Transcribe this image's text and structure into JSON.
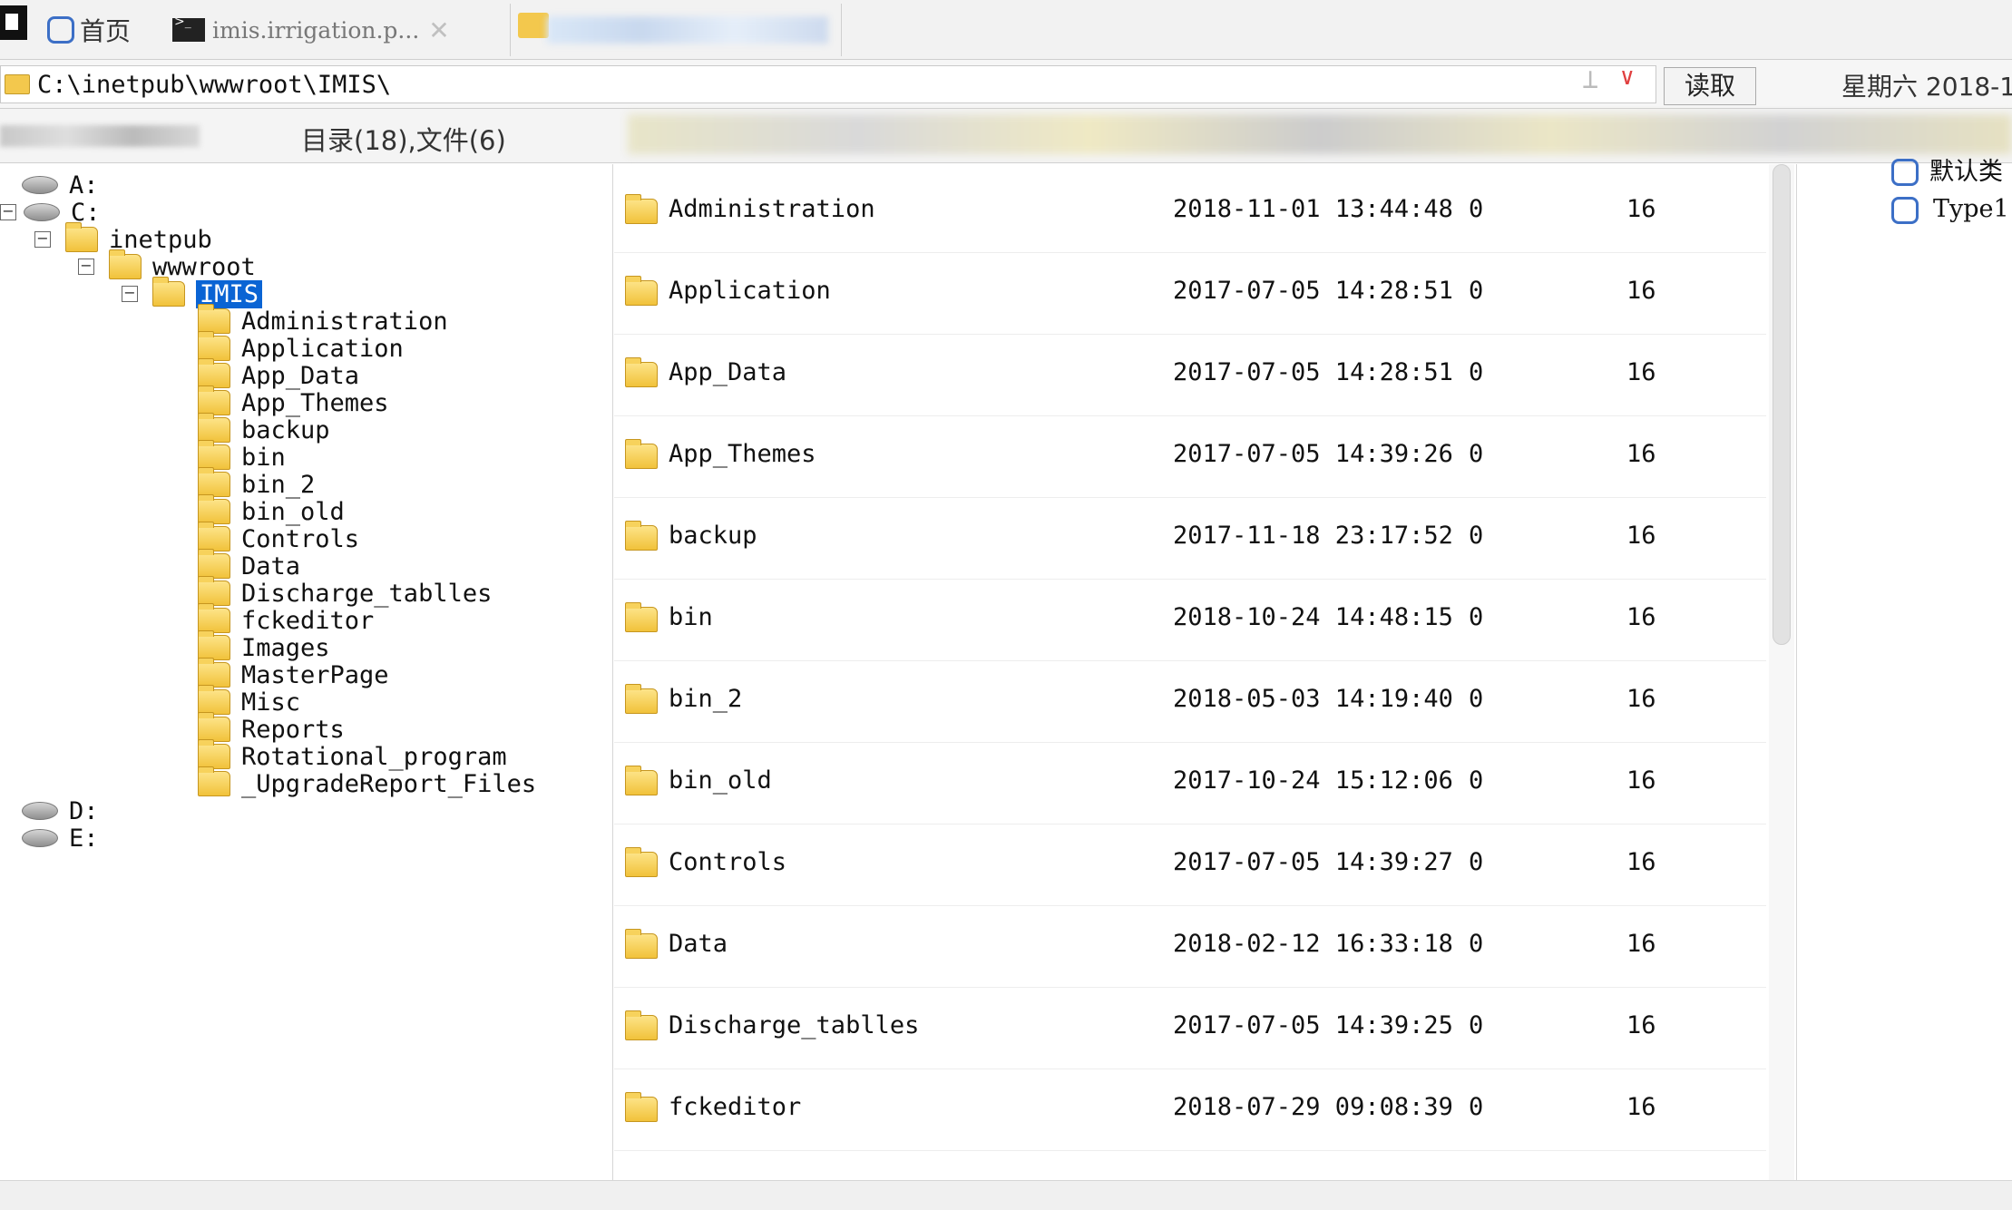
{
  "tabs": {
    "home_label": "首页",
    "file_tab_label": "imis.irrigation.p...",
    "close_glyph": "✕"
  },
  "address": {
    "path": "C:\\inetpub\\wwwroot\\IMIS\\",
    "read_button": "读取",
    "date_text": "星期六 2018-1"
  },
  "info": {
    "counts": "目录(18),文件(6)"
  },
  "tree": {
    "drives_top": [
      "A:",
      "C:"
    ],
    "inetpub": "inetpub",
    "wwwroot": "wwwroot",
    "selected": "IMIS",
    "children": [
      "Administration",
      "Application",
      "App_Data",
      "App_Themes",
      "backup",
      "bin",
      "bin_2",
      "bin_old",
      "Controls",
      "Data",
      "Discharge_tablles",
      "fckeditor",
      "Images",
      "MasterPage",
      "Misc",
      "Reports",
      "Rotational_program",
      "_UpgradeReport_Files"
    ],
    "drives_bottom": [
      "D:",
      "E:"
    ]
  },
  "files": [
    {
      "name": "Administration",
      "date": "2018-11-01 13:44:48",
      "size": "0",
      "perm": "16"
    },
    {
      "name": "Application",
      "date": "2017-07-05 14:28:51",
      "size": "0",
      "perm": "16"
    },
    {
      "name": "App_Data",
      "date": "2017-07-05 14:28:51",
      "size": "0",
      "perm": "16"
    },
    {
      "name": "App_Themes",
      "date": "2017-07-05 14:39:26",
      "size": "0",
      "perm": "16"
    },
    {
      "name": "backup",
      "date": "2017-11-18 23:17:52",
      "size": "0",
      "perm": "16"
    },
    {
      "name": "bin",
      "date": "2018-10-24 14:48:15",
      "size": "0",
      "perm": "16"
    },
    {
      "name": "bin_2",
      "date": "2018-05-03 14:19:40",
      "size": "0",
      "perm": "16"
    },
    {
      "name": "bin_old",
      "date": "2017-10-24 15:12:06",
      "size": "0",
      "perm": "16"
    },
    {
      "name": "Controls",
      "date": "2017-07-05 14:39:27",
      "size": "0",
      "perm": "16"
    },
    {
      "name": "Data",
      "date": "2018-02-12 16:33:18",
      "size": "0",
      "perm": "16"
    },
    {
      "name": "Discharge_tablles",
      "date": "2017-07-05 14:39:25",
      "size": "0",
      "perm": "16"
    },
    {
      "name": "fckeditor",
      "date": "2018-07-29 09:08:39",
      "size": "0",
      "perm": "16"
    }
  ],
  "right_panel": {
    "items": [
      "默认类",
      "Type1"
    ]
  },
  "colors": {
    "selection": "#0a64d4",
    "folder": "#f1c23a",
    "accent_blue": "#3c6fc6",
    "dropdown_red": "#e04040"
  }
}
